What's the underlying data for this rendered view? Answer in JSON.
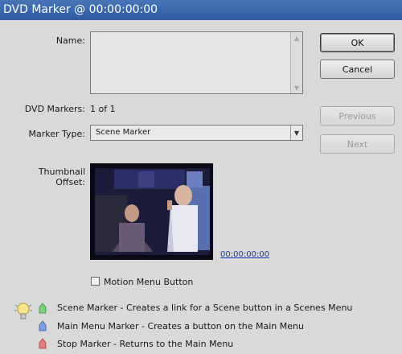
{
  "window": {
    "title": "DVD Marker @ 00:00:00:00"
  },
  "form": {
    "name_label": "Name:",
    "name_value": "",
    "dvd_markers_label": "DVD Markers:",
    "dvd_markers_value": "1 of 1",
    "marker_type_label": "Marker Type:",
    "marker_type_value": "Scene Marker",
    "thumbnail_offset_label": "Thumbnail Offset:",
    "thumbnail_timecode": "00:00:00:00",
    "motion_menu_label": "Motion Menu Button",
    "motion_menu_checked": false
  },
  "buttons": {
    "ok": "OK",
    "cancel": "Cancel",
    "previous": "Previous",
    "next": "Next"
  },
  "legend": [
    {
      "text": "Scene Marker - Creates a link for a Scene button in a Scenes Menu",
      "color": "#7fd07f",
      "icon": "green-marker-icon"
    },
    {
      "text": "Main Menu Marker - Creates a button on the Main Menu",
      "color": "#7f9fe0",
      "icon": "blue-marker-icon"
    },
    {
      "text": "Stop Marker - Returns to the Main Menu",
      "color": "#e07f7f",
      "icon": "red-marker-icon"
    }
  ]
}
